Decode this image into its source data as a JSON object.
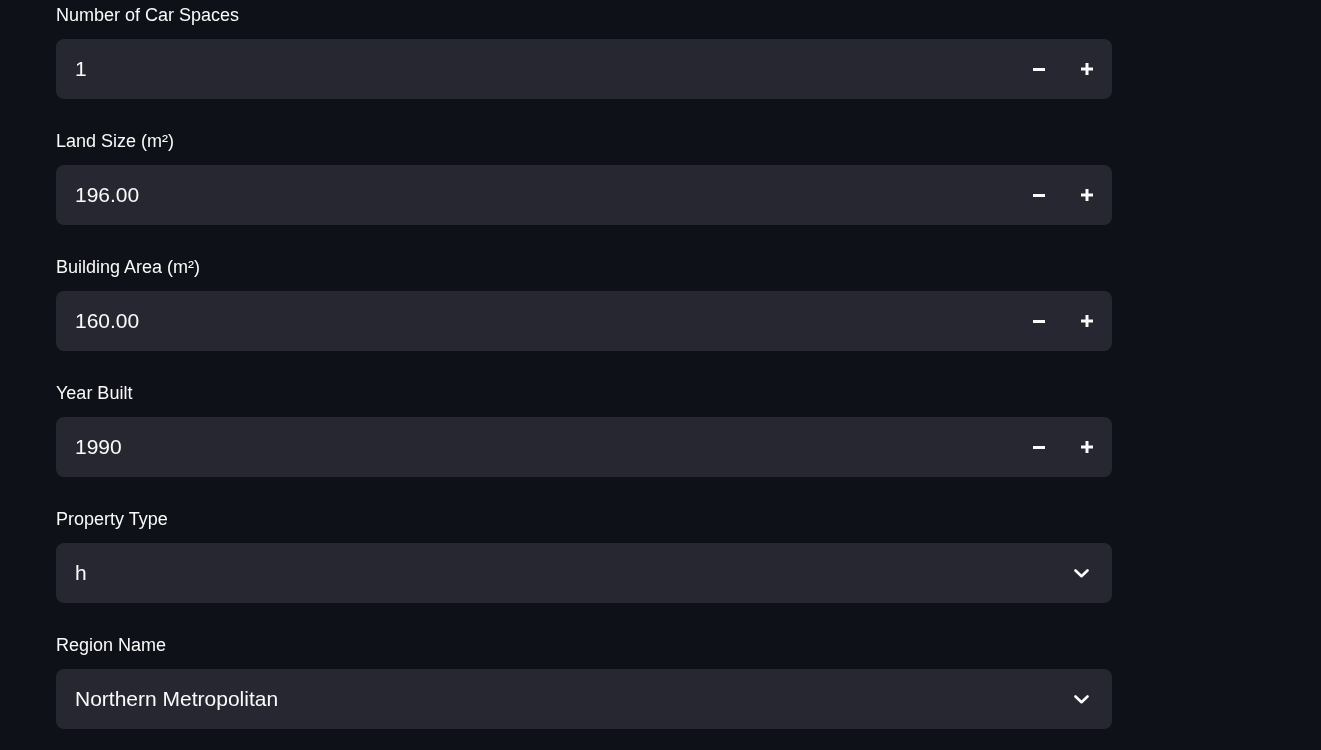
{
  "fields": [
    {
      "kind": "number",
      "label": "Number of Car Spaces",
      "value": "1"
    },
    {
      "kind": "number",
      "label": "Land Size (m²)",
      "value": "196.00"
    },
    {
      "kind": "number",
      "label": "Building Area (m²)",
      "value": "160.00"
    },
    {
      "kind": "number",
      "label": "Year Built",
      "value": "1990"
    },
    {
      "kind": "select",
      "label": "Property Type",
      "value": "h"
    },
    {
      "kind": "select",
      "label": "Region Name",
      "value": "Northern Metropolitan"
    }
  ]
}
